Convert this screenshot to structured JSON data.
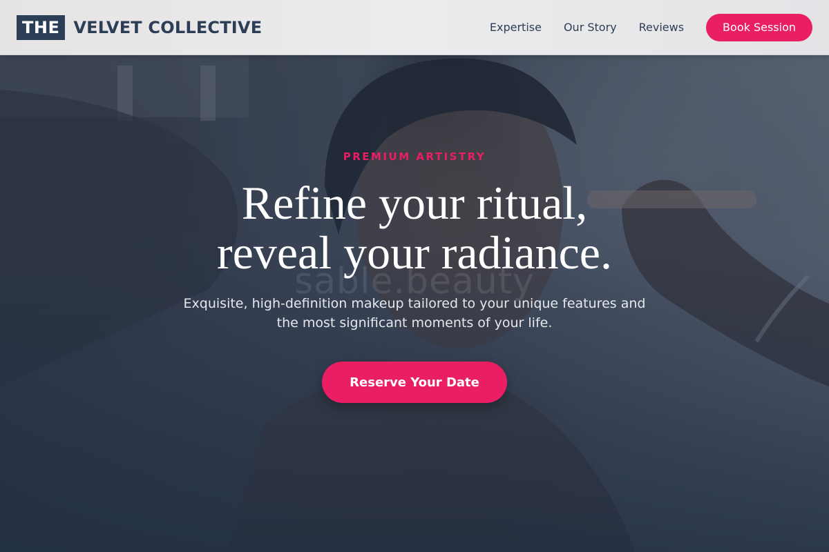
{
  "header": {
    "logo_mark": "THE",
    "logo_text": "VELVET COLLECTIVE",
    "nav": [
      {
        "label": "Expertise"
      },
      {
        "label": "Our Story"
      },
      {
        "label": "Reviews"
      }
    ],
    "book_button": "Book Session"
  },
  "hero": {
    "eyebrow": "PREMIUM ARTISTRY",
    "headline_line1": "Refine your ritual,",
    "headline_line2": "reveal your radiance.",
    "watermark": "sable.beauty",
    "subtitle": "Exquisite, high-definition makeup tailored to your unique features and the most significant moments of your life.",
    "cta": "Reserve Your Date"
  },
  "colors": {
    "accent": "#e91e63",
    "brand": "#2c3e55",
    "header_bg": "#ececee"
  }
}
